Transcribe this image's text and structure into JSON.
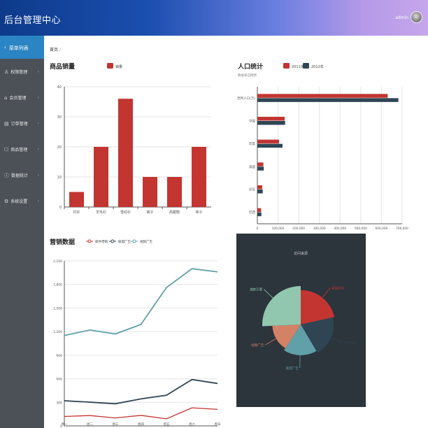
{
  "header": {
    "title": "后台管理中心",
    "user": "admin"
  },
  "sidebar": {
    "menu_title": "菜单列表",
    "items": [
      {
        "label": "权限管理",
        "icon": "user-icon"
      },
      {
        "label": "会员管理",
        "icon": "home-icon"
      },
      {
        "label": "订单管理",
        "icon": "list-icon"
      },
      {
        "label": "商品管理",
        "icon": "package-icon"
      },
      {
        "label": "数据统计",
        "icon": "info-icon"
      },
      {
        "label": "系统设置",
        "icon": "gear-icon"
      }
    ]
  },
  "breadcrumb": "首页",
  "colors": {
    "red": "#c23531",
    "navy": "#2f4554",
    "teal": "#61a0a8",
    "orange": "#d48265",
    "mint": "#91c7ae",
    "darkbg": "#2c343c"
  },
  "chart_data": [
    {
      "type": "bar",
      "title": "商品销量",
      "legend": [
        "销量"
      ],
      "categories": [
        "衬衫",
        "羊毛衫",
        "雪纺衫",
        "裤子",
        "高跟鞋",
        "袜子"
      ],
      "series": [
        {
          "name": "销量",
          "values": [
            5,
            20,
            36,
            10,
            10,
            20
          ]
        }
      ],
      "ylim": [
        0,
        40
      ],
      "yticks": [
        "0",
        "10",
        "20",
        "30",
        "40"
      ]
    },
    {
      "type": "bar",
      "orientation": "horizontal",
      "title": "人口统计",
      "subtitle": "数据来自网络",
      "legend": [
        "2011年",
        "2012年"
      ],
      "categories": [
        "世界人口(万)",
        "中国",
        "印度",
        "美国",
        "印尼",
        "巴西"
      ],
      "series": [
        {
          "name": "2011年",
          "values": [
            630230,
            131744,
            104970,
            29034,
            23489,
            18203
          ]
        },
        {
          "name": "2012年",
          "values": [
            681807,
            134141,
            121594,
            31000,
            26000,
            19325
          ]
        }
      ],
      "xlim": [
        0,
        700000
      ],
      "xticks": [
        "0",
        "100,000",
        "200,000",
        "300,000",
        "400,000",
        "500,000",
        "600,000",
        "700,000"
      ]
    },
    {
      "type": "line",
      "title": "营销数据",
      "legend": [
        "邮件营销",
        "联盟广告",
        "视频广告"
      ],
      "categories": [
        "周一",
        "周二",
        "周三",
        "周四",
        "周五",
        "周六",
        "周日"
      ],
      "series": [
        {
          "name": "邮件营销",
          "values": [
            120,
            132,
            101,
            134,
            90,
            230,
            210
          ]
        },
        {
          "name": "联盟广告",
          "values": [
            320,
            302,
            282,
            344,
            390,
            590,
            540
          ]
        },
        {
          "name": "视频广告",
          "values": [
            1150,
            1220,
            1170,
            1290,
            1760,
            2000,
            1960
          ]
        }
      ],
      "ylim": [
        0,
        2100
      ],
      "yticks": [
        "0",
        "300",
        "600",
        "900",
        "1,200",
        "1,500",
        "1,800",
        "2,100"
      ]
    },
    {
      "type": "pie",
      "title": "访问来源",
      "slices": [
        {
          "name": "直接访问",
          "value": 335
        },
        {
          "name": "邮件营销",
          "value": 310
        },
        {
          "name": "联盟广告",
          "value": 274
        },
        {
          "name": "视频广告",
          "value": 235
        },
        {
          "name": "搜索引擎",
          "value": 400
        }
      ]
    }
  ]
}
